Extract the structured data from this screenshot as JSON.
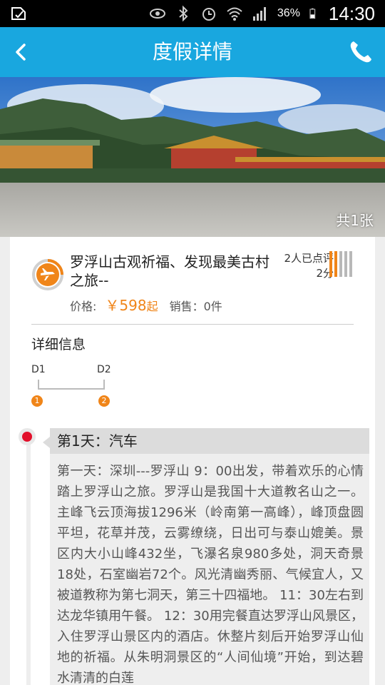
{
  "status_bar": {
    "battery_percent": "36%",
    "time": "14:30"
  },
  "title_bar": {
    "title": "度假详情"
  },
  "hero": {
    "image_count": "共1张"
  },
  "product": {
    "title": "罗浮山古观祈福、发现最美古村之旅--",
    "rating_count": "2人已点评",
    "rating_score": "2分",
    "price_label": "价格:",
    "price_value": "￥598",
    "price_suffix": "起",
    "sales_label": "销售：",
    "sales_value": "0件",
    "accent_color": "#f08519"
  },
  "details": {
    "heading": "详细信息",
    "timeline": [
      {
        "day": "D1",
        "num": "1"
      },
      {
        "day": "D2",
        "num": "2"
      }
    ]
  },
  "itinerary": {
    "day_title": "第1天：汽车",
    "day_text": "第一天：深圳---罗浮山 9：00出发，带着欢乐的心情踏上罗浮山之旅。罗浮山是我国十大道教名山之一。主峰飞云顶海拔1296米（岭南第一高峰），峰顶盘圆平坦，花草并茂，云雾缭绕，日出可与泰山媲美。景区内大小山峰432坐，飞瀑名泉980多处，洞天奇景18处，石室幽岩72个。风光清幽秀丽、气候宜人，又被道教称为第七洞天，第三十四福地。 11：30左右到达龙华镇用午餐。 12：30用完餐直达罗浮山风景区，入住罗浮山景区内的酒店。休整片刻后开始罗浮山仙地的祈福。从朱明洞景区的“人间仙境”开始，到达碧水清清的白莲"
  },
  "colors": {
    "header_blue": "#19a7df",
    "accent_orange": "#f08519",
    "marker_red": "#e2102b"
  }
}
